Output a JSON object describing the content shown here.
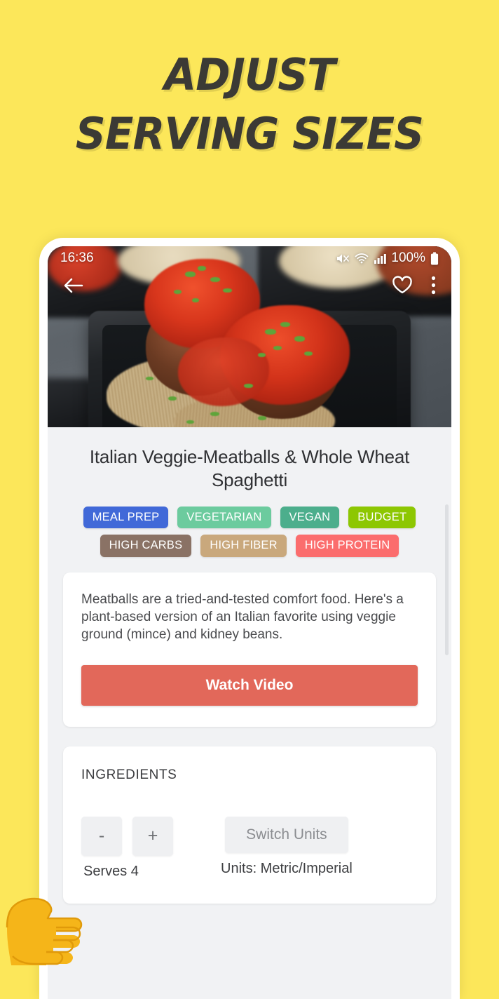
{
  "promo": {
    "line1": "ADJUST",
    "line2": "SERVING SIZES",
    "background_color": "#fce75a",
    "text_color": "#3b3a35"
  },
  "status_bar": {
    "time": "16:36",
    "battery_percent": "100%",
    "icons": [
      "mute-icon",
      "wifi-icon",
      "cellular-signal-icon",
      "battery-icon"
    ]
  },
  "hero": {
    "alt": "Spaghetti and veggie meatballs in black meal-prep container",
    "nav": {
      "back_icon": "back-arrow-icon",
      "favorite_icon": "heart-outline-icon",
      "overflow_icon": "more-vertical-icon"
    }
  },
  "recipe": {
    "title": "Italian Veggie-Meatballs & Whole Wheat Spaghetti",
    "tags": [
      {
        "label": "MEAL PREP",
        "color": "#4169d8"
      },
      {
        "label": "VEGETARIAN",
        "color": "#6ccb9e"
      },
      {
        "label": "VEGAN",
        "color": "#4cae8c"
      },
      {
        "label": "BUDGET",
        "color": "#8dc702"
      },
      {
        "label": "HIGH CARBS",
        "color": "#8a7265"
      },
      {
        "label": "HIGH FIBER",
        "color": "#c9a87c"
      },
      {
        "label": "HIGH PROTEIN",
        "color": "#fb6d6d"
      }
    ],
    "description": "Meatballs are a tried-and-tested comfort food. Here's a plant-based version of an Italian favorite using veggie ground (mince) and kidney beans.",
    "watch_video_label": "Watch Video",
    "watch_video_color": "#e2685a"
  },
  "ingredients": {
    "heading": "INGREDIENTS",
    "decrease_label": "-",
    "increase_label": "+",
    "serves_label": "Serves 4",
    "switch_units_label": "Switch Units",
    "units_label": "Units: Metric/Imperial"
  },
  "pointer": {
    "icon": "pointing-right-hand-emoji"
  }
}
